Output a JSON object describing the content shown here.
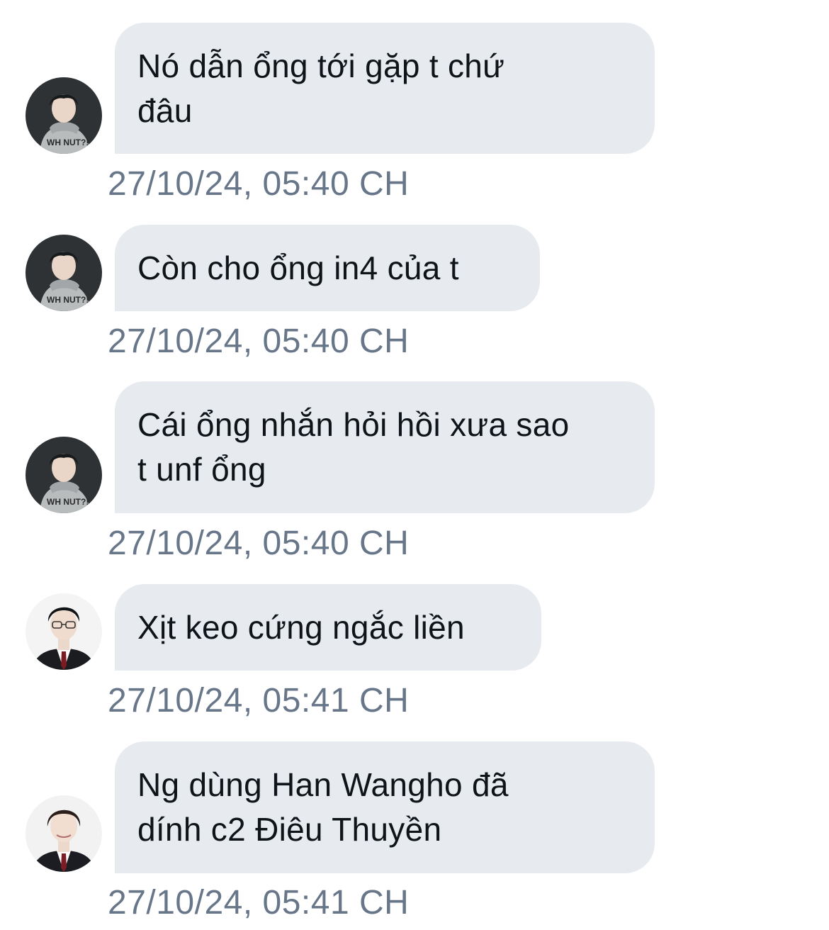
{
  "messages": [
    {
      "avatar": "user-avatar-hoodie",
      "line1": "Nó dẫn ổng tới gặp t chứ",
      "line2": "đâu",
      "time": "27/10/24, 05:40 CH"
    },
    {
      "avatar": "user-avatar-hoodie",
      "line1": "Còn cho ổng in4 của t",
      "time": "27/10/24, 05:40 CH"
    },
    {
      "avatar": "user-avatar-hoodie",
      "line1": "Cái ổng nhắn hỏi hồi xưa sao",
      "line2": "t unf ổng",
      "time": "27/10/24, 05:40 CH"
    },
    {
      "avatar": "user-avatar-glasses-suit",
      "line1": "Xịt keo cứng ngắc liền",
      "time": "27/10/24, 05:41 CH"
    },
    {
      "avatar": "user-avatar-suit",
      "line1": "Ng dùng Han Wangho đã",
      "line2": "dính c2 Điêu Thuyền",
      "time": "27/10/24, 05:41 CH"
    }
  ],
  "colors": {
    "bubble": "#e7ebf0",
    "text": "#0f1419",
    "timestamp": "#68768a"
  }
}
